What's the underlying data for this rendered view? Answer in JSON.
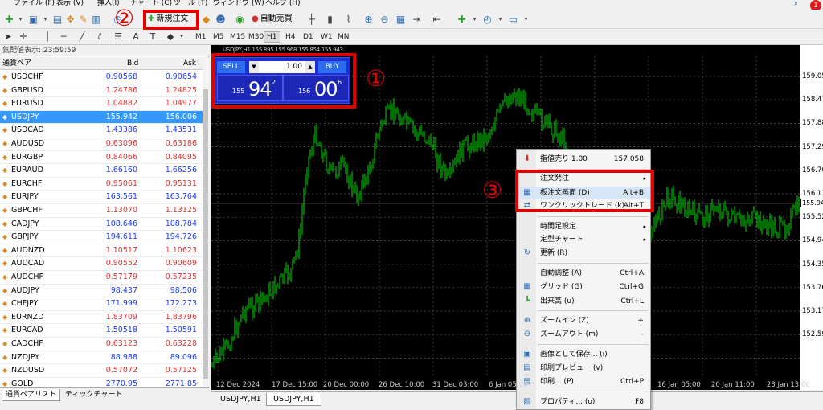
{
  "menubar": {
    "items": [
      "ファイル (F)",
      "表示 (V)",
      "挿入(I)",
      "チャート (C)",
      "ツール (T)",
      "ウィンドウ (W)",
      "ヘルプ (H)"
    ]
  },
  "toolbar": {
    "new_order": "新規注文",
    "auto_trade": "自動売買"
  },
  "timeframes": [
    "M1",
    "M5",
    "M15",
    "M30",
    "H1",
    "H4",
    "D1",
    "W1",
    "MN"
  ],
  "active_timeframe": "H1",
  "market_watch": {
    "title": "気配値表示: 23:59:59",
    "col_symbol": "通貨ペア",
    "col_bid": "Bid",
    "col_ask": "Ask",
    "rows": [
      {
        "symbol": "USDCHF",
        "bid": "0.90568",
        "ask": "0.90654",
        "color": "blue"
      },
      {
        "symbol": "GBPUSD",
        "bid": "1.24786",
        "ask": "1.24825",
        "color": "red"
      },
      {
        "symbol": "EURUSD",
        "bid": "1.04882",
        "ask": "1.04977",
        "color": "red"
      },
      {
        "symbol": "USDJPY",
        "bid": "155.942",
        "ask": "156.006",
        "color": "blue"
      },
      {
        "symbol": "USDCAD",
        "bid": "1.43386",
        "ask": "1.43531",
        "color": "blue"
      },
      {
        "symbol": "AUDUSD",
        "bid": "0.63096",
        "ask": "0.63186",
        "color": "red"
      },
      {
        "symbol": "EURGBP",
        "bid": "0.84066",
        "ask": "0.84095",
        "color": "red"
      },
      {
        "symbol": "EURAUD",
        "bid": "1.66160",
        "ask": "1.66256",
        "color": "blue"
      },
      {
        "symbol": "EURCHF",
        "bid": "0.95061",
        "ask": "0.95131",
        "color": "red"
      },
      {
        "symbol": "EURJPY",
        "bid": "163.561",
        "ask": "163.764",
        "color": "blue"
      },
      {
        "symbol": "GBPCHF",
        "bid": "1.13070",
        "ask": "1.13125",
        "color": "red"
      },
      {
        "symbol": "CADJPY",
        "bid": "108.646",
        "ask": "108.784",
        "color": "blue"
      },
      {
        "symbol": "GBPJPY",
        "bid": "194.611",
        "ask": "194.726",
        "color": "blue"
      },
      {
        "symbol": "AUDNZD",
        "bid": "1.10517",
        "ask": "1.10623",
        "color": "red"
      },
      {
        "symbol": "AUDCAD",
        "bid": "0.90552",
        "ask": "0.90609",
        "color": "red"
      },
      {
        "symbol": "AUDCHF",
        "bid": "0.57179",
        "ask": "0.57235",
        "color": "red"
      },
      {
        "symbol": "AUDJPY",
        "bid": "98.437",
        "ask": "98.506",
        "color": "blue"
      },
      {
        "symbol": "CHFJPY",
        "bid": "171.999",
        "ask": "172.273",
        "color": "blue"
      },
      {
        "symbol": "EURNZD",
        "bid": "1.83709",
        "ask": "1.83796",
        "color": "red"
      },
      {
        "symbol": "EURCAD",
        "bid": "1.50518",
        "ask": "1.50591",
        "color": "blue"
      },
      {
        "symbol": "CADCHF",
        "bid": "0.63123",
        "ask": "0.63228",
        "color": "red"
      },
      {
        "symbol": "NZDJPY",
        "bid": "88.988",
        "ask": "89.096",
        "color": "blue"
      },
      {
        "symbol": "NZDUSD",
        "bid": "0.57072",
        "ask": "0.57125",
        "color": "red"
      },
      {
        "symbol": "GOLD",
        "bid": "2770.95",
        "ask": "2771.85",
        "color": "blue"
      }
    ],
    "tabs": [
      "通貨ペアリスト",
      "ティックチャート"
    ]
  },
  "chart": {
    "info": "USDJPY,H1  155.895 155.968 155.854 155.943",
    "price_labels": [
      "159.05",
      "158.47",
      "157.88",
      "157.29",
      "156.70",
      "156.11",
      "155.52",
      "154.94",
      "154.35",
      "153.76",
      "153.17",
      "152.59"
    ],
    "current_price": "155.94",
    "time_labels": [
      "12 Dec 2024",
      "17 Dec 15:00",
      "20 Dec 00:00",
      "26 Dec 10:00",
      "31 Dec 03:00",
      "6 Jan 05:00",
      "16 Jan 05:00",
      "20 Jan 11:00",
      "23 Jan 13:00"
    ],
    "tabs": [
      "USDJPY,H1",
      "USDJPY,H1"
    ],
    "active_tab": 1,
    "candle_color": "#00c800"
  },
  "one_click": {
    "sell_label": "SELL",
    "buy_label": "BUY",
    "lot": "1.00",
    "sell_prefix": "155",
    "sell_big": "94",
    "sell_sup": "2",
    "buy_prefix": "156",
    "buy_big": "00",
    "buy_sup": "6"
  },
  "context_menu": {
    "items": [
      {
        "label": "指値売り 1.00",
        "key": "157.058",
        "icon": "sell-limit-icon",
        "sym": "⬇"
      },
      {
        "label": "注文発注",
        "key": "",
        "submenu": true
      },
      {
        "label": "板注文画面 (D)",
        "key": "Alt+B",
        "icon": "dom-icon",
        "sym": "▦",
        "hl": true
      },
      {
        "label": "ワンクリックトレード (k)",
        "key": "Alt+T",
        "icon": "one-click-icon",
        "sym": "⇄"
      },
      {
        "label": "時間足設定",
        "key": "",
        "submenu": true
      },
      {
        "label": "定型チャート",
        "key": "",
        "submenu": true
      },
      {
        "label": "更新 (R)",
        "key": "",
        "icon": "refresh-icon",
        "sym": "↻"
      },
      {
        "label": "自動調整 (A)",
        "key": "Ctrl+A"
      },
      {
        "label": "グリッド (G)",
        "key": "Ctrl+G",
        "icon": "grid-icon",
        "sym": "▦"
      },
      {
        "label": "出来高 (u)",
        "key": "Ctrl+L",
        "icon": "volume-icon",
        "sym": "┗"
      },
      {
        "label": "ズームイン (Z)",
        "key": "+",
        "icon": "zoom-in-icon",
        "sym": "⊕"
      },
      {
        "label": "ズームアウト (m)",
        "key": "-",
        "icon": "zoom-out-icon",
        "sym": "⊖"
      },
      {
        "label": "画像として保存... (i)",
        "key": "",
        "icon": "save-image-icon",
        "sym": "▣"
      },
      {
        "label": "印刷プレビュー (v)",
        "key": "",
        "icon": "print-preview-icon",
        "sym": "▤"
      },
      {
        "label": "印刷... (P)",
        "key": "Ctrl+P",
        "icon": "print-icon",
        "sym": "▤"
      },
      {
        "label": "プロパティ... (o)",
        "key": "F8",
        "icon": "properties-icon",
        "sym": "▨"
      }
    ]
  },
  "annotations": {
    "one": "①",
    "two": "②",
    "three": "③"
  },
  "colors": {
    "accent_red": "#e00000",
    "panel_blue": "#1f2dd6",
    "selected_row": "#3399ff"
  }
}
